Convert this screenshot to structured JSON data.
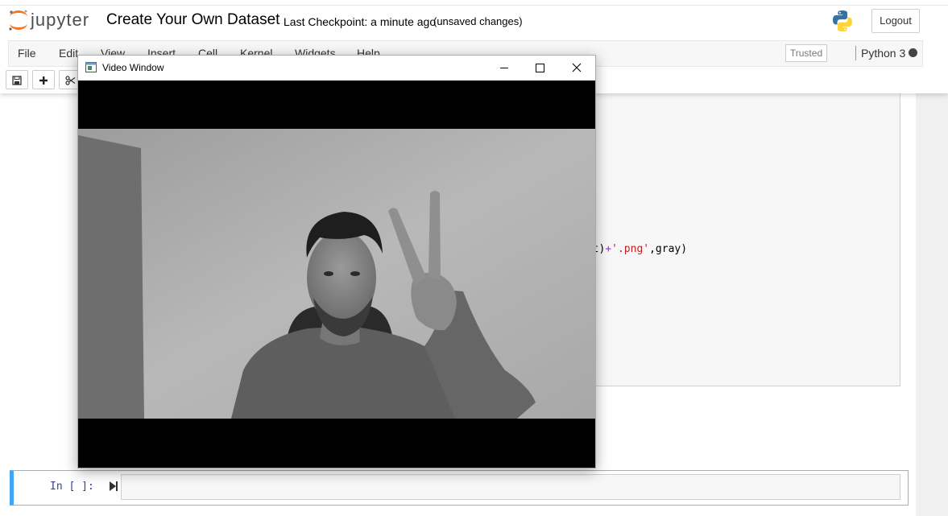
{
  "header": {
    "logo_text": "jupyter",
    "notebook_title": "Create Your Own Dataset",
    "checkpoint": "Last Checkpoint: a minute ago",
    "save_status": "(unsaved changes)",
    "logout_label": "Logout"
  },
  "menubar": {
    "items": [
      {
        "label": "File"
      },
      {
        "label": "Edit"
      },
      {
        "label": "View"
      },
      {
        "label": "Insert"
      },
      {
        "label": "Cell"
      },
      {
        "label": "Kernel"
      },
      {
        "label": "Widgets"
      },
      {
        "label": "Help"
      }
    ],
    "trusted_label": "Trusted",
    "kernel_name": "Python 3"
  },
  "toolbar": {
    "icons": [
      "save-icon",
      "add-cell-icon",
      "cut-icon"
    ]
  },
  "code_cell": {
    "visible_code": {
      "before": "unt)",
      "op": "+",
      "string": "'.png'",
      "after": ",gray)"
    }
  },
  "input_cell": {
    "prompt": "In [ ]:"
  },
  "video_window": {
    "title": "Video Window"
  },
  "colors": {
    "jupyter_orange": "#f37626",
    "active_cell_border": "#42a5f5",
    "prompt_blue": "#303f9f",
    "string_red": "#ba2121",
    "operator_purple": "#aa22ff"
  }
}
